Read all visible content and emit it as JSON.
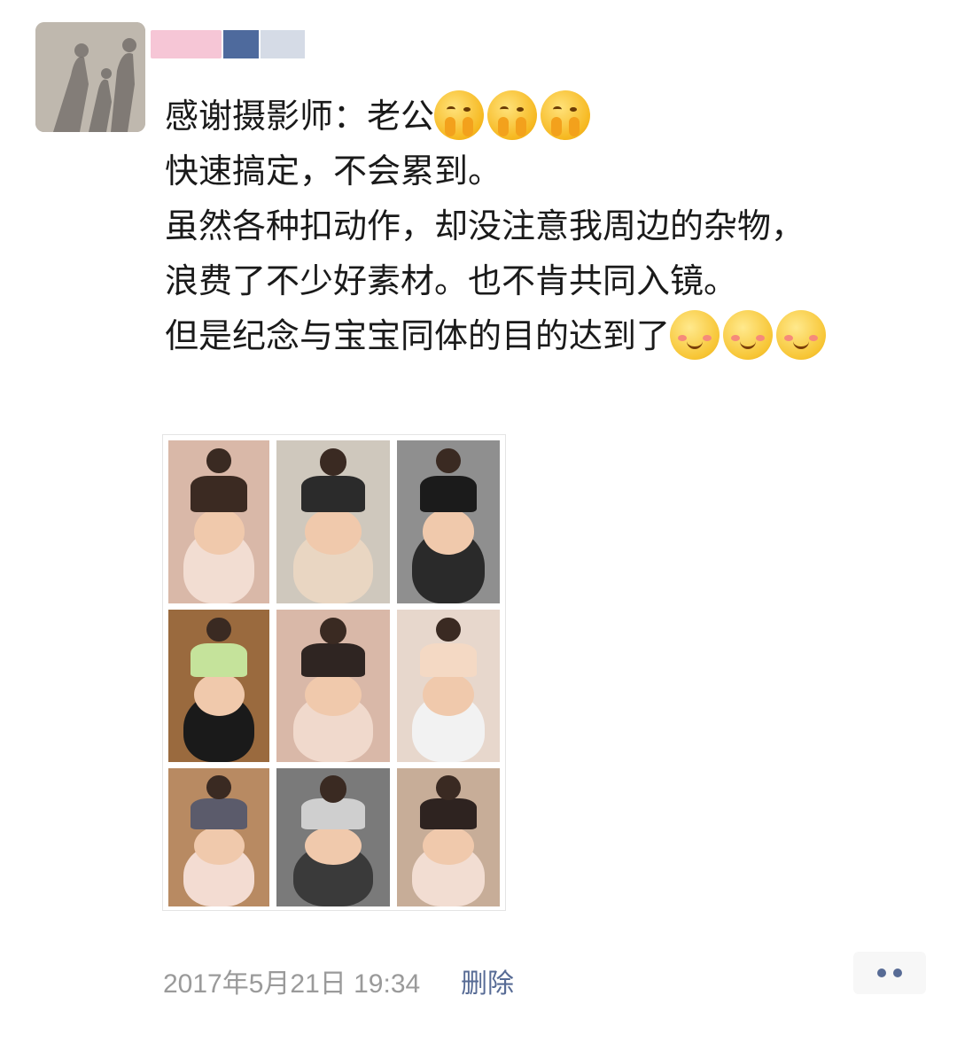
{
  "post": {
    "author_name": "",
    "lines": [
      "感谢摄影师：老公",
      "快速搞定，不会累到。",
      "虽然各种扣动作，却没注意我周边的杂物，",
      "浪费了不少好素材。也不肯共同入镜。",
      "但是纪念与宝宝同体的目的达到了"
    ],
    "line1_emojis": [
      "shy-emoji",
      "shy-emoji",
      "shy-emoji"
    ],
    "line5_emojis": [
      "smile-emoji",
      "smile-emoji",
      "smile-emoji"
    ],
    "timestamp": "2017年5月21日 19:34",
    "delete_label": "删除"
  },
  "photos": [
    {
      "name": "photo-1",
      "bg": "#d9b8a8",
      "top": "#3b2a22",
      "skirt": "#f2ddd2"
    },
    {
      "name": "photo-2",
      "bg": "#cfc8bd",
      "top": "#2b2b2b",
      "skirt": "#e9d6c2"
    },
    {
      "name": "photo-3",
      "bg": "#8f8f8f",
      "top": "#1b1b1b",
      "skirt": "#2a2a2a"
    },
    {
      "name": "photo-4",
      "bg": "#9a6a3e",
      "top": "#c5e39b",
      "skirt": "#1a1a1a"
    },
    {
      "name": "photo-5",
      "bg": "#d9b8a8",
      "top": "#2f2522",
      "skirt": "#f0d9cc"
    },
    {
      "name": "photo-6",
      "bg": "#e7d7cc",
      "top": "#f4d9c4",
      "skirt": "#f2f2f2"
    },
    {
      "name": "photo-7",
      "bg": "#b88a62",
      "top": "#5b5b6b",
      "skirt": "#f3dcd2"
    },
    {
      "name": "photo-8",
      "bg": "#7a7a7a",
      "top": "#cfcfcf",
      "skirt": "#3a3a3a"
    },
    {
      "name": "photo-9",
      "bg": "#c7ad98",
      "top": "#2e2320",
      "skirt": "#f2ddd2"
    }
  ],
  "colors": {
    "link": "#576b95",
    "timestamp": "#9a9a9a",
    "text": "#1a1a1a"
  }
}
